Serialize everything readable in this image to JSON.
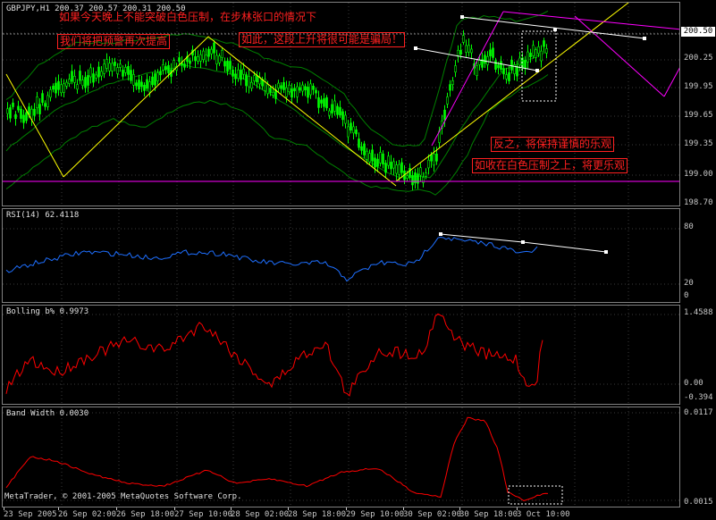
{
  "main": {
    "header": "GBPJPY,H1  200.37 200.57 200.31 200.50",
    "current_price": "200.50",
    "scale": [
      "200.50",
      "200.25",
      "199.95",
      "199.65",
      "199.35",
      "199.00",
      "198.70"
    ],
    "notes": {
      "line1": "如果今天晚上不能突破白色压制，在步林张口的情况下",
      "line2": "我们将把预警再次提高",
      "line3": "如此，这段上升将很可能是骗局！",
      "line4": "反之，将保持谨慎的乐观",
      "line5": "如收在白色压制之上，将更乐观"
    }
  },
  "rsi": {
    "title": "RSI(14) 62.4118",
    "scale": [
      "80",
      "20",
      "0"
    ]
  },
  "boll": {
    "title": "Bolling b%  0.9973",
    "scale": [
      "1.4588",
      "0.00",
      "-0.394"
    ]
  },
  "bw": {
    "title": "Band Width  0.0030",
    "scale": [
      "0.0117",
      "0.0015"
    ]
  },
  "copyright": "MetaTrader, © 2001-2005 MetaQuotes Software Corp.",
  "time_axis": [
    "23 Sep 2005",
    "26 Sep 02:00",
    "26 Sep 18:00",
    "27 Sep 10:00",
    "28 Sep 02:00",
    "28 Sep 18:00",
    "29 Sep 10:00",
    "30 Sep 02:00",
    "30 Sep 18:00",
    "3 Oct 10:00"
  ],
  "colors": {
    "candles": "#00ff00",
    "bands": "#008000",
    "trendline": "#ffff00",
    "channel": "#ff00ff",
    "resistance": "#ffffff",
    "rsi_line": "#1e6fff",
    "boll_line": "#ff0000",
    "bw_line": "#ff0000",
    "notes": "#ff2020"
  }
}
